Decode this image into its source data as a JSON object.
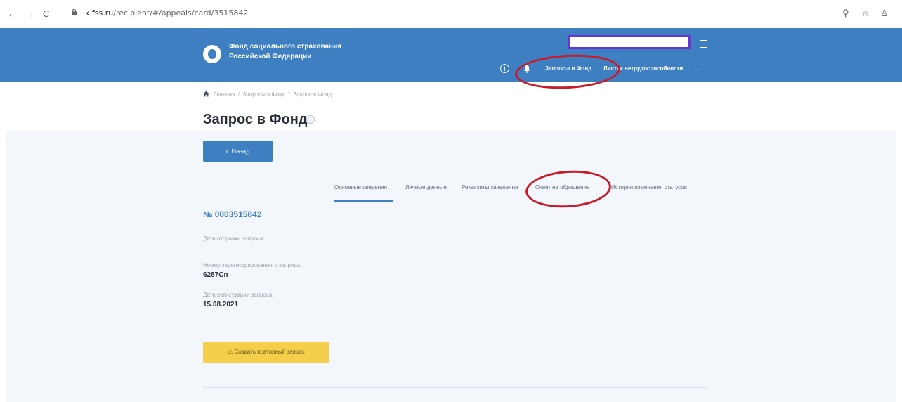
{
  "browser": {
    "back": "←",
    "forward": "→",
    "reload": "C",
    "url_host": "lk.fss.ru",
    "url_path": "/recipient/#/appeals/card/3515842",
    "icons": [
      "zoom-icon",
      "star-icon",
      "profile-icon"
    ]
  },
  "header": {
    "logo_line1": "Фонд социального страхования",
    "logo_line2": "Российской Федерации",
    "search_value": "",
    "nav": {
      "requests": "Запросы в Фонд",
      "sick_leave": "Листки нетрудоспособности",
      "more": "..."
    }
  },
  "page": {
    "breadcrumb": [
      "Главная",
      "Запросы в Фонд",
      "Запрос в Фонд"
    ],
    "title": "Запрос в Фонд",
    "title_info": "i"
  },
  "content": {
    "back_button": "Назад",
    "tabs": [
      "Основные сведения",
      "Личные данные",
      "Реквизиты заявления",
      "Ответ на обращение",
      "История изменения статусов"
    ],
    "request_number": "№ 0003515842",
    "fields": [
      {
        "label": "Дата отправки запроса:",
        "value": "—"
      },
      {
        "label": "Номер зарегистрированного запроса:",
        "value": "6287Сп"
      },
      {
        "label": "Дата регистрации запроса:",
        "value": "15.08.2021"
      }
    ],
    "repeat_button": "Создать повторный запрос"
  },
  "colors": {
    "brand_blue": "#3e7fc2",
    "annotation_red": "#c71b2a",
    "highlight_purple": "#6a34d1",
    "repeat_yellow": "#f5cf4c"
  }
}
